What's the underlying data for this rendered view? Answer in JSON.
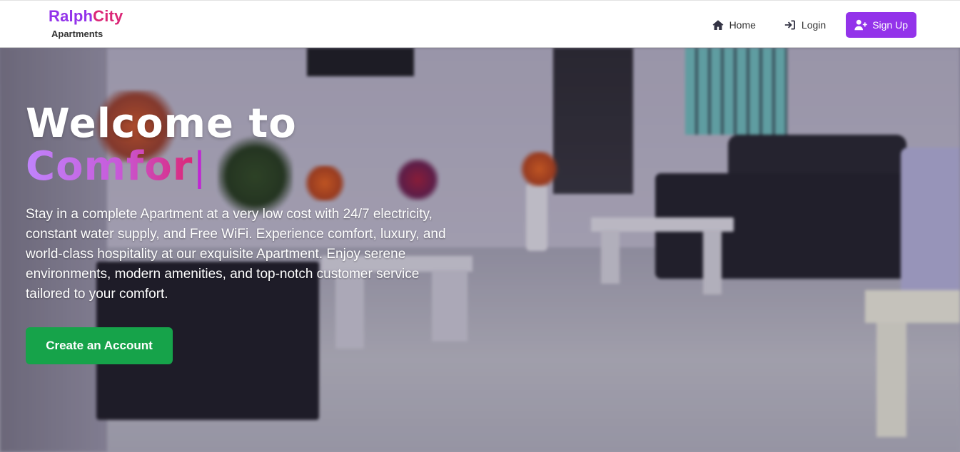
{
  "header": {
    "brand": {
      "name_part1": "Ralph",
      "name_part2": "City",
      "subtitle": "Apartments"
    },
    "nav": {
      "home_label": "Home",
      "home_icon": "home-icon",
      "login_label": "Login",
      "login_icon": "sign-in-icon",
      "signup_label": "Sign Up",
      "signup_icon": "user-plus-icon"
    }
  },
  "hero": {
    "title": "Welcome to",
    "typed_text": "Comfor",
    "cursor": "|",
    "description": "Stay in a complete Apartment at a very low cost with 24/7 electricity, constant water supply, and Free WiFi. Experience comfort, luxury, and world-class hospitality at our exquisite Apartment. Enjoy serene environments, modern amenities, and top-notch customer service tailored to your comfort.",
    "cta_label": "Create an Account",
    "background": "living-room-photo"
  },
  "colors": {
    "brand_purple": "#9333ea",
    "brand_pink": "#db2777",
    "cta_green": "#16a34a",
    "typed_gradient_start": "#c084fc",
    "typed_gradient_end": "#db2777"
  }
}
